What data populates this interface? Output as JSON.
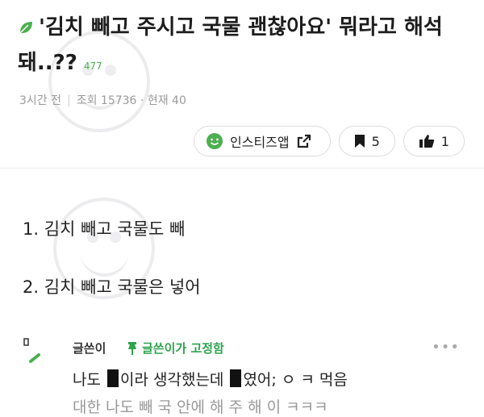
{
  "post": {
    "title": "'김치 빼고 주시고 국물 괜찮아요' 뭐라고 해석 돼..??",
    "title_count": "477",
    "time": "3시간 전",
    "views": "조회 15736",
    "current": "· 현재 40"
  },
  "actions": {
    "source_label": "인스티즈앱",
    "bookmark_count": "5",
    "like_count": "1"
  },
  "content": {
    "items": [
      "1. 김치 빼고 국물도 빼",
      "2. 김치 빼고 국물은 넣어"
    ]
  },
  "comment": {
    "author": "글쓴이",
    "pinned": "글쓴이가 고정함",
    "more": "•••",
    "text_a": "나도 ",
    "text_b": "이라 생각했는데 ",
    "text_c": "였어; ㅇ ㅋ 먹음",
    "text2": "대한 나도 빼 국 안에 해 주 해 이 ㅋㅋㅋ"
  },
  "colors": {
    "accent": "#4caf50",
    "pin": "#2ea44f"
  },
  "icons": [
    "leaf-icon",
    "smiley-icon",
    "share-icon",
    "bookmark-icon",
    "thumbs-up-icon",
    "pin-icon"
  ]
}
